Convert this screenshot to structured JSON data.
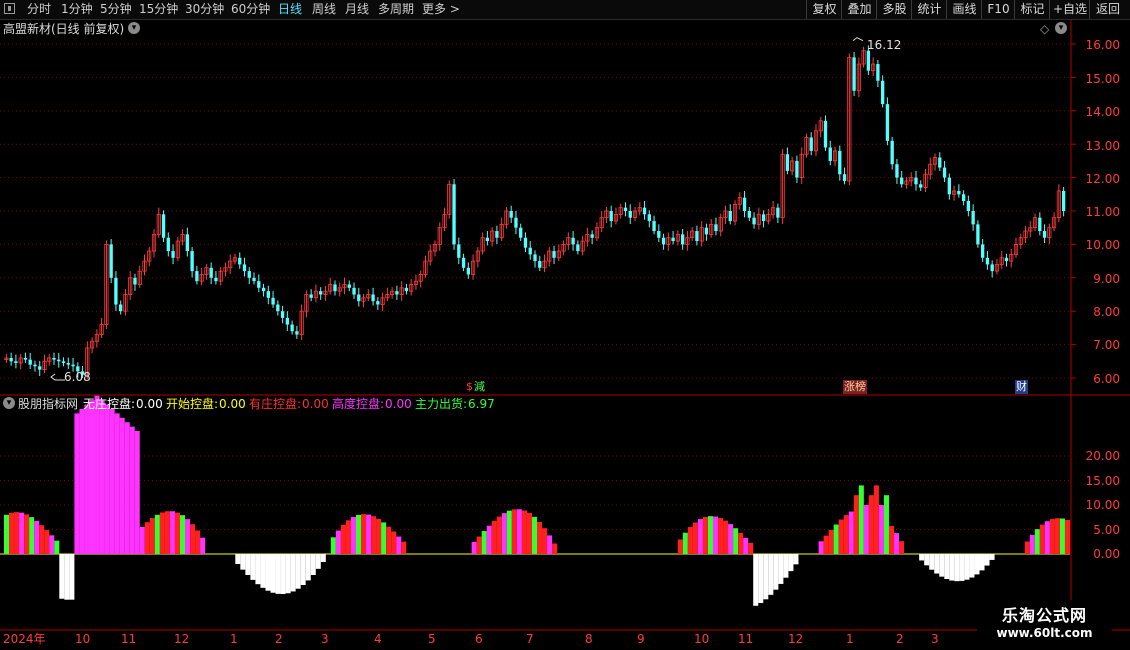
{
  "toolbar": {
    "periods": [
      "分时",
      "1分钟",
      "5分钟",
      "15分钟",
      "30分钟",
      "60分钟",
      "日线",
      "周线",
      "月线",
      "多周期",
      "更多 >"
    ],
    "active_period": "日线",
    "buttons": [
      "复权",
      "叠加",
      "多股",
      "统计",
      "画线",
      "F10",
      "标记",
      "+自选",
      "返回"
    ]
  },
  "main_panel": {
    "title": "高盟新材(日线 前复权)",
    "high_label": "16.12",
    "low_label": "6.08",
    "event_tags": [
      "減",
      "涨榜",
      "财"
    ],
    "y_axis_ticks": [
      "16.00",
      "15.00",
      "14.00",
      "13.00",
      "12.00",
      "11.00",
      "10.00",
      "9.00",
      "8.00",
      "7.00",
      "6.00"
    ]
  },
  "indicator_panel": {
    "name": "股朋指标网",
    "legend": [
      {
        "label": "无庄控盘:",
        "value": "0.00",
        "color": "#ffffff"
      },
      {
        "label": "开始控盘:",
        "value": "0.00",
        "color": "#ffff00"
      },
      {
        "label": "有庄控盘:",
        "value": "0.00",
        "color": "#ff3030"
      },
      {
        "label": "高度控盘:",
        "value": "0.00",
        "color": "#ff33ff"
      },
      {
        "label": "主力出货:",
        "value": "6.97",
        "color": "#33ff33"
      }
    ],
    "y_axis_ticks": [
      "20.00",
      "15.00",
      "10.00",
      "5.00",
      "0.00"
    ]
  },
  "time_axis": [
    "2024年",
    "10",
    "11",
    "12",
    "1",
    "2",
    "3",
    "4",
    "5",
    "6",
    "7",
    "8",
    "9",
    "10",
    "11",
    "12",
    "1",
    "2",
    "3"
  ],
  "watermark": {
    "title": "乐淘公式网",
    "url": "www.60lt.com"
  },
  "colors": {
    "up": "#ff3c3c",
    "down": "#54ffff",
    "grid": "#7a0000",
    "axis": "#b00000"
  },
  "chart_data": {
    "type": "candlestick",
    "title": "高盟新材(日线 前复权)",
    "ylim": [
      5.6,
      16.6
    ],
    "close": [
      6.6,
      6.5,
      6.45,
      6.6,
      6.55,
      6.4,
      6.35,
      6.25,
      6.5,
      6.6,
      6.55,
      6.5,
      6.45,
      6.4,
      6.35,
      6.2,
      6.1,
      6.9,
      7.1,
      7.3,
      7.6,
      10.0,
      9.0,
      8.2,
      8.0,
      8.5,
      9.0,
      8.8,
      9.2,
      9.5,
      9.8,
      10.3,
      10.9,
      10.2,
      9.8,
      9.6,
      10.1,
      10.3,
      9.8,
      9.2,
      8.9,
      9.1,
      9.3,
      9.0,
      8.9,
      9.2,
      9.3,
      9.5,
      9.6,
      9.4,
      9.2,
      9.0,
      8.9,
      8.7,
      8.6,
      8.4,
      8.2,
      8.0,
      7.8,
      7.6,
      7.4,
      7.3,
      8.0,
      8.5,
      8.4,
      8.6,
      8.5,
      8.6,
      8.8,
      8.6,
      8.7,
      8.8,
      8.7,
      8.5,
      8.3,
      8.4,
      8.5,
      8.3,
      8.2,
      8.4,
      8.5,
      8.6,
      8.5,
      8.7,
      8.6,
      8.8,
      8.9,
      9.1,
      9.5,
      9.8,
      10.0,
      10.5,
      10.9,
      11.8,
      10.0,
      9.6,
      9.3,
      9.1,
      9.5,
      9.8,
      10.2,
      10.1,
      10.4,
      10.2,
      10.6,
      11.0,
      10.8,
      10.5,
      10.2,
      9.9,
      9.7,
      9.5,
      9.3,
      9.5,
      9.8,
      9.6,
      9.8,
      10.0,
      10.2,
      10.0,
      9.8,
      10.1,
      10.3,
      10.2,
      10.5,
      10.8,
      11.0,
      10.7,
      10.9,
      11.1,
      11.0,
      10.8,
      11.0,
      11.1,
      10.9,
      10.7,
      10.4,
      10.2,
      10.0,
      10.2,
      10.1,
      10.3,
      10.0,
      10.2,
      10.4,
      10.1,
      10.5,
      10.3,
      10.6,
      10.4,
      10.8,
      11.0,
      10.7,
      11.2,
      11.4,
      11.0,
      10.8,
      10.6,
      10.9,
      10.7,
      10.9,
      11.1,
      10.8,
      12.7,
      12.2,
      12.5,
      12.0,
      12.7,
      13.2,
      12.8,
      13.4,
      13.7,
      12.9,
      12.5,
      12.8,
      12.1,
      11.9,
      15.6,
      14.6,
      15.4,
      15.8,
      15.2,
      15.4,
      14.9,
      14.2,
      13.1,
      12.4,
      12.0,
      11.8,
      11.9,
      12.0,
      11.8,
      11.7,
      12.1,
      12.4,
      12.6,
      12.3,
      12.0,
      11.5,
      11.6,
      11.5,
      11.3,
      11.0,
      10.6,
      10.0,
      9.6,
      9.4,
      9.2,
      9.4,
      9.6,
      9.5,
      9.7,
      10.0,
      10.2,
      10.4,
      10.5,
      10.8,
      10.4,
      10.2,
      10.5,
      10.8,
      11.6,
      11.0
    ],
    "indicator_series": [
      "无庄控盘",
      "开始控盘",
      "有庄控盘",
      "高度控盘",
      "主力出货"
    ],
    "indicator_ylim": [
      -16,
      25
    ]
  }
}
